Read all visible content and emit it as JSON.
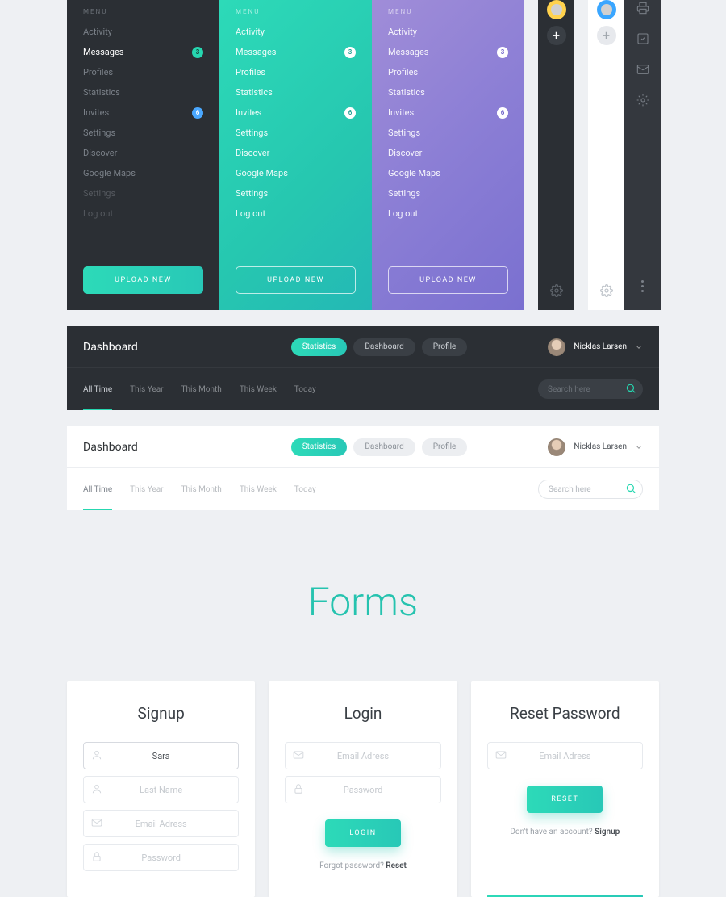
{
  "menu_head": "MENU",
  "upload_label": "UPLOAD NEW",
  "nav_items": {
    "activity": "Activity",
    "messages": "Messages",
    "profiles": "Profiles",
    "statistics": "Statistics",
    "invites": "Invites",
    "settings": "Settings",
    "discover": "Discover",
    "gmaps": "Google Maps",
    "settings2": "Settings",
    "logout": "Log out"
  },
  "badges": {
    "dark_messages": "3",
    "dark_invites": "6",
    "teal_messages": "3",
    "teal_invites": "6",
    "purple_messages": "3",
    "purple_invites": "6"
  },
  "plus": "+",
  "header": {
    "title": "Dashboard",
    "pills": {
      "statistics": "Statistics",
      "dashboard": "Dashboard",
      "profile": "Profile"
    },
    "user": "Nicklas Larsen",
    "tabs": {
      "all_time": "All Time",
      "this_year": "This Year",
      "this_month": "This Month",
      "this_week": "This Week",
      "today": "Today"
    },
    "search_placeholder": "Search here"
  },
  "forms_title": "Forms",
  "signup": {
    "title": "Signup",
    "first_name_value": "Sara",
    "last_name_ph": "Last Name",
    "email_ph": "Email Adress",
    "password_ph": "Password"
  },
  "login": {
    "title": "Login",
    "email_ph": "Email Adress",
    "password_ph": "Password",
    "submit": "LOGIN",
    "hint_pre": "Forgot password? ",
    "hint_action": "Reset"
  },
  "reset": {
    "title": "Reset Password",
    "email_ph": "Email Adress",
    "submit": "RESET",
    "hint_pre": "Don't have an account? ",
    "hint_action": "Signup"
  }
}
